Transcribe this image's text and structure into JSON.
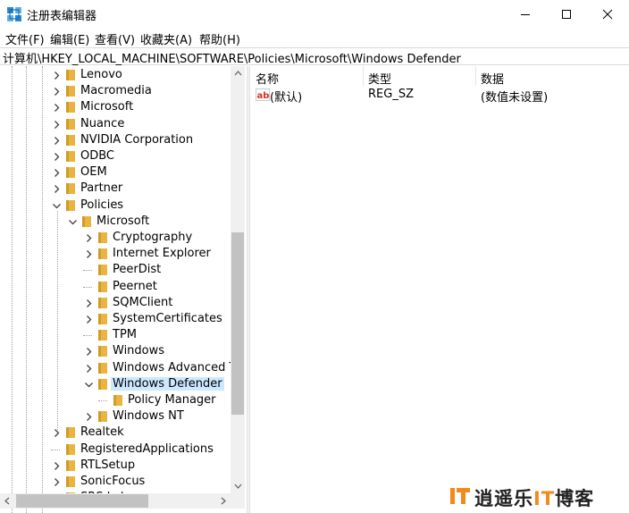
{
  "window": {
    "title": "注册表编辑器",
    "icon": "regedit-icon",
    "controls": {
      "minimize": "minimize-icon",
      "maximize": "maximize-icon",
      "close": "close-icon"
    }
  },
  "menu": [
    {
      "label": "文件(F)"
    },
    {
      "label": "编辑(E)"
    },
    {
      "label": "查看(V)"
    },
    {
      "label": "收藏夹(A)"
    },
    {
      "label": "帮助(H)"
    }
  ],
  "address": "计算机\\HKEY_LOCAL_MACHINE\\SOFTWARE\\Policies\\Microsoft\\Windows Defender",
  "tree": [
    {
      "label": "Lenovo",
      "level": 0,
      "expander": "collapsed"
    },
    {
      "label": "Macromedia",
      "level": 0,
      "expander": "collapsed"
    },
    {
      "label": "Microsoft",
      "level": 0,
      "expander": "collapsed"
    },
    {
      "label": "Nuance",
      "level": 0,
      "expander": "collapsed"
    },
    {
      "label": "NVIDIA Corporation",
      "level": 0,
      "expander": "collapsed"
    },
    {
      "label": "ODBC",
      "level": 0,
      "expander": "collapsed"
    },
    {
      "label": "OEM",
      "level": 0,
      "expander": "collapsed"
    },
    {
      "label": "Partner",
      "level": 0,
      "expander": "collapsed"
    },
    {
      "label": "Policies",
      "level": 0,
      "expander": "expanded"
    },
    {
      "label": "Microsoft",
      "level": 1,
      "expander": "expanded"
    },
    {
      "label": "Cryptography",
      "level": 2,
      "expander": "collapsed"
    },
    {
      "label": "Internet Explorer",
      "level": 2,
      "expander": "collapsed"
    },
    {
      "label": "PeerDist",
      "level": 2,
      "expander": "none"
    },
    {
      "label": "Peernet",
      "level": 2,
      "expander": "none"
    },
    {
      "label": "SQMClient",
      "level": 2,
      "expander": "collapsed"
    },
    {
      "label": "SystemCertificates",
      "level": 2,
      "expander": "collapsed"
    },
    {
      "label": "TPM",
      "level": 2,
      "expander": "none"
    },
    {
      "label": "Windows",
      "level": 2,
      "expander": "collapsed"
    },
    {
      "label": "Windows Advanced T",
      "level": 2,
      "expander": "collapsed"
    },
    {
      "label": "Windows Defender",
      "level": 2,
      "expander": "expanded",
      "selected": true
    },
    {
      "label": "Policy Manager",
      "level": 3,
      "expander": "none"
    },
    {
      "label": "Windows NT",
      "level": 2,
      "expander": "collapsed"
    },
    {
      "label": "Realtek",
      "level": 0,
      "expander": "collapsed"
    },
    {
      "label": "RegisteredApplications",
      "level": 0,
      "expander": "none"
    },
    {
      "label": "RTLSetup",
      "level": 0,
      "expander": "collapsed"
    },
    {
      "label": "SonicFocus",
      "level": 0,
      "expander": "collapsed"
    },
    {
      "label": "SRS Labs",
      "level": 0,
      "expander": "collapsed"
    }
  ],
  "list": {
    "columns": [
      {
        "label": "名称"
      },
      {
        "label": "类型"
      },
      {
        "label": "数据"
      }
    ],
    "rows": [
      {
        "name": "(默认)",
        "type": "REG_SZ",
        "data": "(数值未设置)",
        "icon": "string-value-icon"
      }
    ]
  },
  "watermark": {
    "prefix": "逍遥乐",
    "it": "IT",
    "suffix": "博客"
  },
  "colors": {
    "folder": "#e8b543",
    "folder_dark": "#d39b24",
    "selection": "#cce8ff",
    "accent": "#f28a1b",
    "titleicon": "#2b88d8"
  }
}
